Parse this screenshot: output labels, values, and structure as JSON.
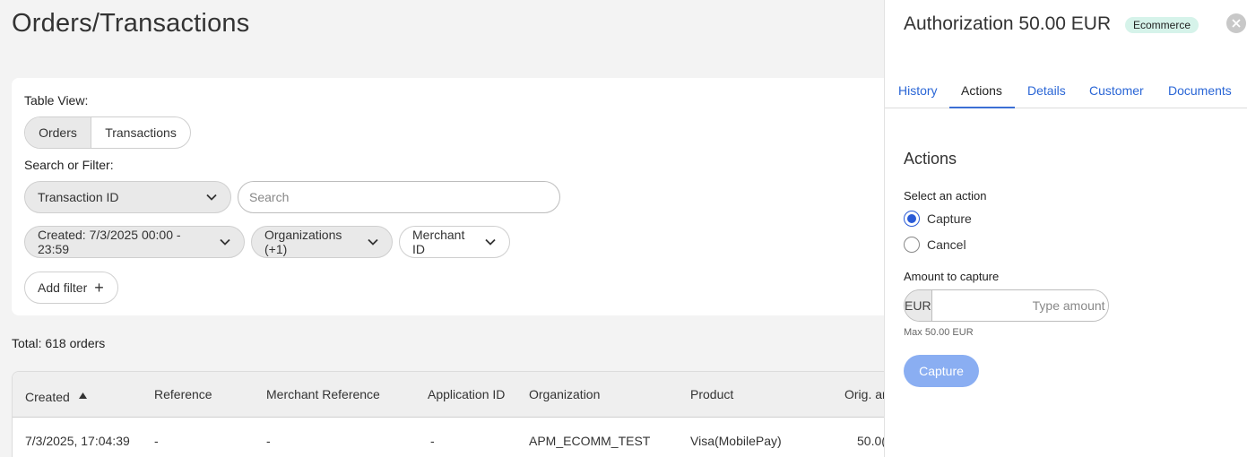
{
  "page": {
    "title": "Orders/Transactions"
  },
  "filters": {
    "table_view_label": "Table View:",
    "views": [
      "Orders",
      "Transactions"
    ],
    "search_label": "Search or Filter:",
    "search_field": "Transaction ID",
    "search_placeholder": "Search",
    "created_filter": "Created: 7/3/2025 00:00 - 23:59",
    "organizations_filter": "Organizations (+1)",
    "merchant_filter": "Merchant ID",
    "add_filter": "Add filter"
  },
  "summary": {
    "total": "Total: 618 orders"
  },
  "table": {
    "columns": [
      "Created",
      "Reference",
      "Merchant Reference",
      "Application ID",
      "Organization",
      "Product",
      "Orig. ar"
    ],
    "rows": [
      [
        "7/3/2025, 17:04:39",
        "-",
        "-",
        "-",
        "APM_ECOMM_TEST",
        "Visa(MobilePay)",
        "50.0("
      ]
    ]
  },
  "panel": {
    "title": "Authorization 50.00 EUR",
    "badge": "Ecommerce",
    "tabs": [
      "History",
      "Actions",
      "Details",
      "Customer",
      "Documents"
    ],
    "active_tab": "Actions",
    "section_title": "Actions",
    "select_label": "Select an action",
    "options": [
      "Capture",
      "Cancel"
    ],
    "selected_option": "Capture",
    "amount_label": "Amount to capture",
    "currency": "EUR",
    "amount_placeholder": "Type amount",
    "max_note": "Max 50.00 EUR",
    "submit_label": "Capture"
  },
  "colors": {
    "accent": "#2a5bd7",
    "link": "#2a66d6",
    "badge_bg": "#d6f3ea",
    "button_disabled": "#8aaef2"
  }
}
